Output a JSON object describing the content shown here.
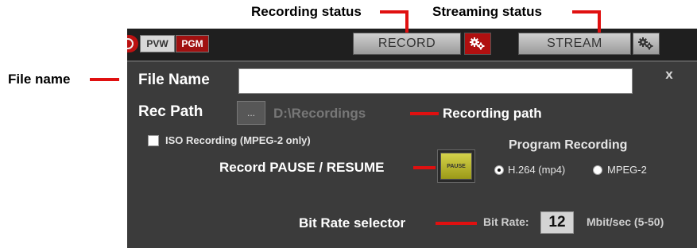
{
  "annotations": {
    "recording_status": "Recording status",
    "streaming_status": "Streaming status",
    "file_name": "File name",
    "recording_path": "Recording path",
    "record_pause_resume": "Record PAUSE / RESUME",
    "bit_rate_selector": "Bit Rate selector"
  },
  "toolbar": {
    "pvw_label": "PVW",
    "pgm_label": "PGM",
    "record_label": "RECORD",
    "stream_label": "STREAM"
  },
  "form": {
    "file_name_label": "File Name",
    "file_name_value": "",
    "rec_path_label": "Rec Path",
    "browse_label": "...",
    "rec_path_value": "D:\\Recordings",
    "iso_label": "ISO Recording (MPEG-2 only)",
    "pause_label": "PAUSE",
    "program_recording_label": "Program Recording",
    "format_options": [
      {
        "label": "H.264 (mp4)",
        "selected": true
      },
      {
        "label": "MPEG-2",
        "selected": false
      }
    ],
    "bit_rate_label": "Bit Rate:",
    "bit_rate_value": "12",
    "bit_rate_unit": "Mbit/sec (5-50)",
    "close_label": "x"
  },
  "colors": {
    "panel": "#3b3b3b",
    "accent_red": "#e01010",
    "pgm_red": "#a01010",
    "pause_yellow": "#c8c63a"
  },
  "icons": [
    "gear-icon",
    "close-icon"
  ]
}
